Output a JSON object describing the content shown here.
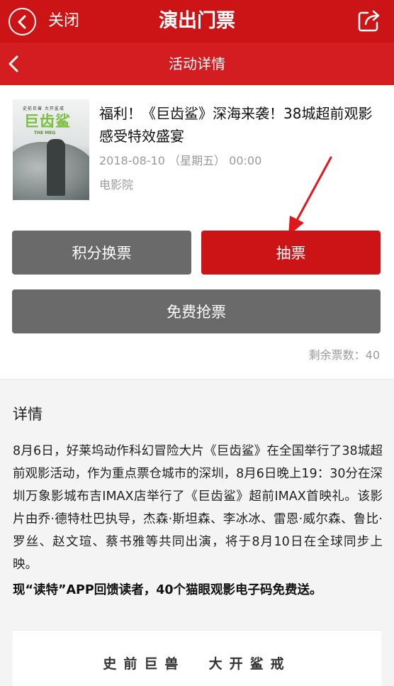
{
  "header": {
    "close_label": "关闭",
    "title": "演出门票",
    "back_icon": "chevron-left-circle-icon",
    "share_icon": "share-icon",
    "bar_color": "#cc1417"
  },
  "subheader": {
    "title": "活动详情",
    "back_icon": "chevron-left-icon"
  },
  "event": {
    "poster": {
      "top_text": "史前巨兽   大开鲨戒",
      "logo_text": "巨齿鲨",
      "sub_text": "THE MEG"
    },
    "title": "福利！《巨齿鲨》深海来袭！38城超前观影感受特效盛宴",
    "date": "2018-08-10 （星期五） 00:00",
    "venue": "电影院"
  },
  "actions": {
    "points_label": "积分换票",
    "draw_label": "抽票",
    "free_label": "免费抢票",
    "remaining_label": "剩余票数：",
    "remaining_count": "40",
    "accent_color": "#cc1417",
    "gray_color": "#6a6a6a"
  },
  "details": {
    "heading": "详情",
    "body": "8月6日，好莱坞动作科幻冒险大片《巨齿鲨》在全国举行了38城超前观影活动，作为重点票仓城市的深圳，8月6日晚上19：30分在深圳万象影城布吉IMAX店举行了《巨齿鲨》超前IMAX首映礼。该影片由乔·德特杜巴执导，杰森·斯坦森、李冰冰、雷恩·威尔森、鲁比·罗丝、赵文瑄、蔡书雅等共同出演，将于8月10日在全球同步上映。",
    "promo": "现“读特”APP回馈读者，40个猫眼观影电子码免费送。",
    "image_caption": "史前巨兽  大开鲨戒"
  }
}
